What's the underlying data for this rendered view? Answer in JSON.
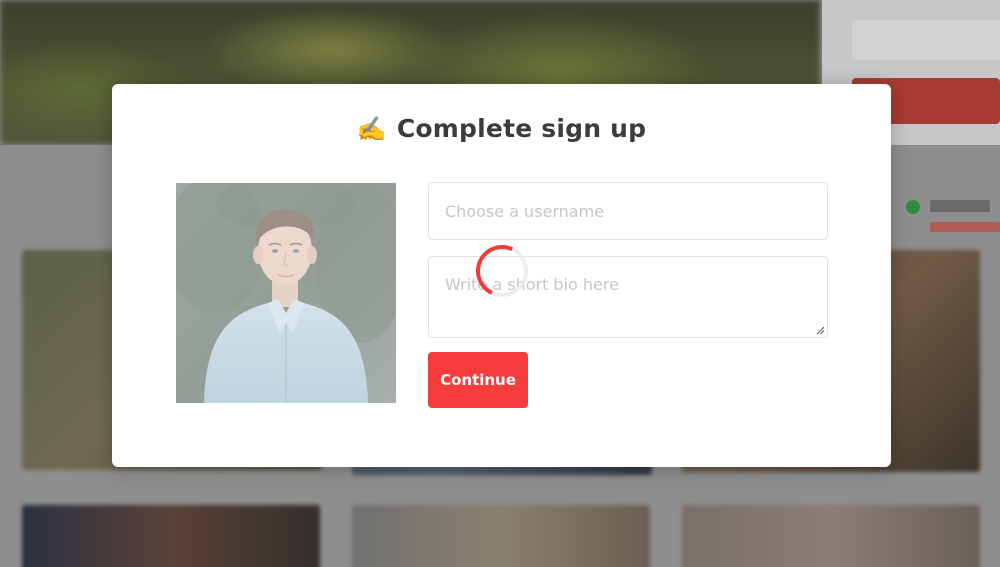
{
  "modal": {
    "title_icon": "✍️",
    "title_icon_name": "writing-hand-icon",
    "title": "Complete sign up",
    "photo_alt": "Profile photo",
    "username_placeholder": "Choose a username",
    "username_value": "",
    "bio_placeholder": "Write a short bio here",
    "bio_value": "",
    "continue_label": "Continue"
  },
  "colors": {
    "accent": "#f63c3c",
    "title_text": "#3c3c3c",
    "placeholder_text": "#c6c6c6",
    "overlay": "#8e8e8e"
  },
  "loading": {
    "visible": true,
    "icon": "loading-spinner-icon"
  }
}
